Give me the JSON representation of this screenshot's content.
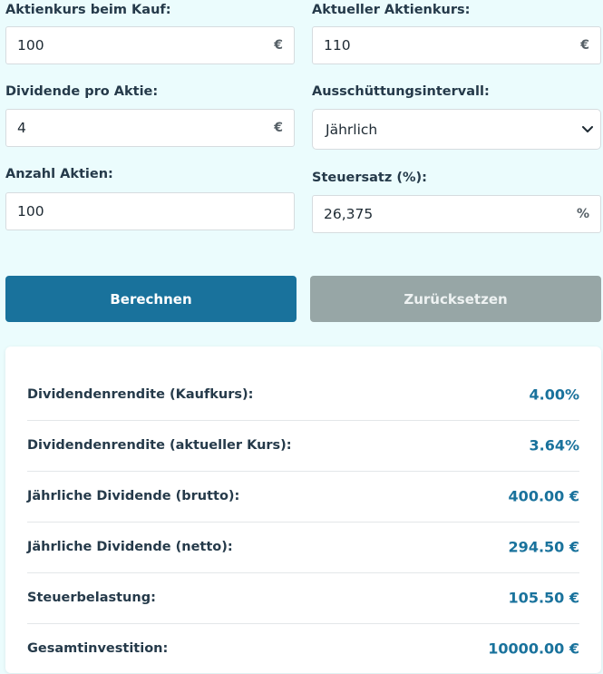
{
  "form": {
    "purchase_price": {
      "label": "Aktienkurs beim Kauf:",
      "value": "100",
      "unit": "€"
    },
    "current_price": {
      "label": "Aktueller Aktienkurs:",
      "value": "110",
      "unit": "€"
    },
    "dividend_per_share": {
      "label": "Dividende pro Aktie:",
      "value": "4",
      "unit": "€"
    },
    "payout_interval": {
      "label": "Ausschüttungsintervall:",
      "value": "Jährlich"
    },
    "share_count": {
      "label": "Anzahl Aktien:",
      "value": "100"
    },
    "tax_rate": {
      "label": "Steuersatz (%):",
      "value": "26,375",
      "unit": "%"
    }
  },
  "buttons": {
    "calculate": "Berechnen",
    "reset": "Zurücksetzen"
  },
  "colors": {
    "accent": "#19729c",
    "background": "#ebfcfd",
    "reset_button": "#97a6a6"
  },
  "results": [
    {
      "label": "Dividendenrendite (Kaufkurs):",
      "value": "4.00%"
    },
    {
      "label": "Dividendenrendite (aktueller Kurs):",
      "value": "3.64%"
    },
    {
      "label": "Jährliche Dividende (brutto):",
      "value": "400.00 €"
    },
    {
      "label": "Jährliche Dividende (netto):",
      "value": "294.50 €"
    },
    {
      "label": "Steuerbelastung:",
      "value": "105.50 €"
    },
    {
      "label": "Gesamtinvestition:",
      "value": "10000.00 €"
    }
  ]
}
